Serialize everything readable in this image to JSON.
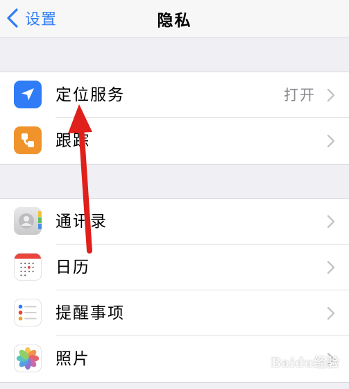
{
  "navbar": {
    "back_label": "设置",
    "title": "隐私"
  },
  "group1": {
    "items": [
      {
        "label": "定位服务",
        "value": "打开",
        "icon": "location-arrow-icon"
      },
      {
        "label": "跟踪",
        "icon": "tracking-icon"
      }
    ]
  },
  "group2": {
    "items": [
      {
        "label": "通讯录",
        "icon": "contacts-icon"
      },
      {
        "label": "日历",
        "icon": "calendar-icon"
      },
      {
        "label": "提醒事项",
        "icon": "reminders-icon"
      },
      {
        "label": "照片",
        "icon": "photos-icon"
      }
    ]
  },
  "colors": {
    "accent": "#2f7cf6",
    "background": "#efeff4",
    "location_icon_bg": "#2f7cf6",
    "tracking_icon_bg": "#f0932b",
    "annotation_arrow": "#e0201b"
  },
  "watermark": "Baidu经验"
}
